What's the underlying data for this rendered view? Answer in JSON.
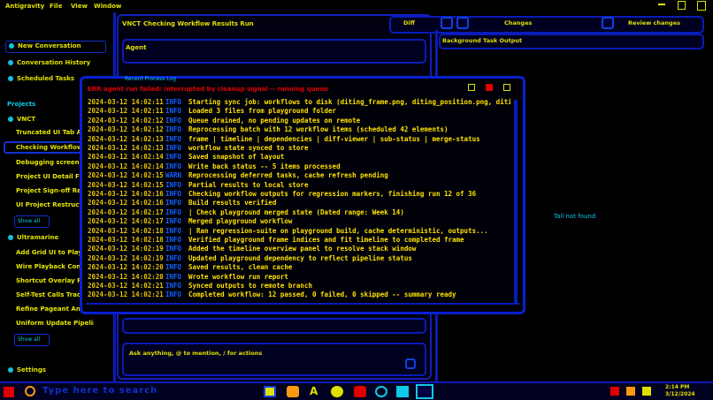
{
  "menubar": {
    "app": "Antigravity",
    "menus": [
      "File",
      "View",
      "Window"
    ]
  },
  "sidebar": {
    "top_items": [
      {
        "label": "New Conversation",
        "icon": "plus-icon"
      },
      {
        "label": "Conversation History",
        "icon": "history-icon"
      },
      {
        "label": "Scheduled Tasks",
        "icon": "clock-icon"
      }
    ],
    "projects_heading": "Projects",
    "project_name": "VNCT",
    "project_items": [
      "Truncated UI Tab Align",
      "Checking Workflow Results",
      "Debugging screen flicker",
      "Project UI Detail Fixes",
      "Project Sign-off Review",
      "UI Project Restructure"
    ],
    "project_more": "Show all",
    "workspace_name": "Ultramarine",
    "workspace_items": [
      "Add Grid UI to Playground",
      "Wire Playback Controls",
      "Shortcut Overlay Polish",
      "Self-Test Calls Tracing",
      "Refine Pageant Animations",
      "Uniform Update Pipeline"
    ],
    "workspace_more": "Show all",
    "settings": "Settings"
  },
  "main": {
    "breadcrumb_root": "VNCT",
    "breadcrumb_title": "Checking Workflow Results Run",
    "mode_chip": "Agent",
    "toolbar_labels": [
      "Diff",
      "Changes",
      "Review changes"
    ],
    "input_placeholder": "Ask anything, @ to mention, / for actions",
    "review_title": "Background Task Output",
    "empty_label": "Tail not found"
  },
  "terminal": {
    "title": "Recent Process Log",
    "tag": "info",
    "header_line": "ERR  agent run failed: interrupted by cleanup signal -- running queue",
    "lines": [
      {
        "t": "2024-03-12 14:02:11",
        "l": "INFO",
        "m": "Starting sync job: workflows to disk (diting_frame.png, diting_position.png, diting_border.png)"
      },
      {
        "t": "2024-03-12 14:02:11",
        "l": "INFO",
        "m": "Loaded 3 files from playground folder"
      },
      {
        "t": "2024-03-12 14:02:12",
        "l": "INFO",
        "m": "Queue drained, no pending updates on remote"
      },
      {
        "t": "2024-03-12 14:02:12",
        "l": "INFO",
        "m": "Reprocessing batch with 12 workflow items (scheduled 42 elements)"
      },
      {
        "t": "2024-03-12 14:02:13",
        "l": "INFO",
        "m": "frame    |   timeline   |   dependencies   |   diff-viewer   |   sub-status   |   merge-status"
      },
      {
        "t": "2024-03-12 14:02:13",
        "l": "INFO",
        "m": "workflow state synced to store"
      },
      {
        "t": "2024-03-12 14:02:14",
        "l": "INFO",
        "m": "Saved snapshot of layout"
      },
      {
        "t": "2024-03-12 14:02:14",
        "l": "INFO",
        "m": "Write back status -- 5 items processed"
      },
      {
        "t": "2024-03-12 14:02:15",
        "l": "WARN",
        "m": "Reprocessing deferred tasks, cache refresh pending"
      },
      {
        "t": "2024-03-12 14:02:15",
        "l": "INFO",
        "m": "Partial results to local store"
      },
      {
        "t": "2024-03-12 14:02:16",
        "l": "INFO",
        "m": "Checking workflow outputs for regression markers, finishing run 12 of 36"
      },
      {
        "t": "2024-03-12 14:02:16",
        "l": "INFO",
        "m": "Build results verified"
      },
      {
        "t": "2024-03-12 14:02:17",
        "l": "INFO",
        "m": "|  Check playground merged state (Dated range: Week 14)"
      },
      {
        "t": "2024-03-12 14:02:17",
        "l": "INFO",
        "m": "Merged playground workflow"
      },
      {
        "t": "2024-03-12 14:02:18",
        "l": "INFO",
        "m": "|  Ran regression-suite on playground build, cache deterministic, outputs..."
      },
      {
        "t": "2024-03-12 14:02:18",
        "l": "INFO",
        "m": "Verified playground frame indices and fit timeline to completed frame"
      },
      {
        "t": "2024-03-12 14:02:19",
        "l": "INFO",
        "m": "Added the timeline overview panel to resolve stack window"
      },
      {
        "t": "2024-03-12 14:02:19",
        "l": "INFO",
        "m": "Updated playground dependency to reflect pipeline status"
      },
      {
        "t": "2024-03-12 14:02:20",
        "l": "INFO",
        "m": "Saved results, clean cache"
      },
      {
        "t": "2024-03-12 14:02:20",
        "l": "INFO",
        "m": "Wrote workflow run report"
      },
      {
        "t": "2024-03-12 14:02:21",
        "l": "INFO",
        "m": "Synced outputs to remote branch"
      },
      {
        "t": "2024-03-12 14:02:21",
        "l": "INFO",
        "m": "Completed workflow: 12 passed, 0 failed, 0 skipped -- summary ready"
      }
    ]
  },
  "taskbar": {
    "search_text": "Type here to search",
    "clock_time": "2:14 PM",
    "clock_date": "3/12/2024"
  },
  "colors": {
    "background": "#000000",
    "accent_blue": "#0a1cb8",
    "text_yellow": "#e0e000",
    "cyan": "#10c8e8",
    "alert_red": "#e00000"
  }
}
